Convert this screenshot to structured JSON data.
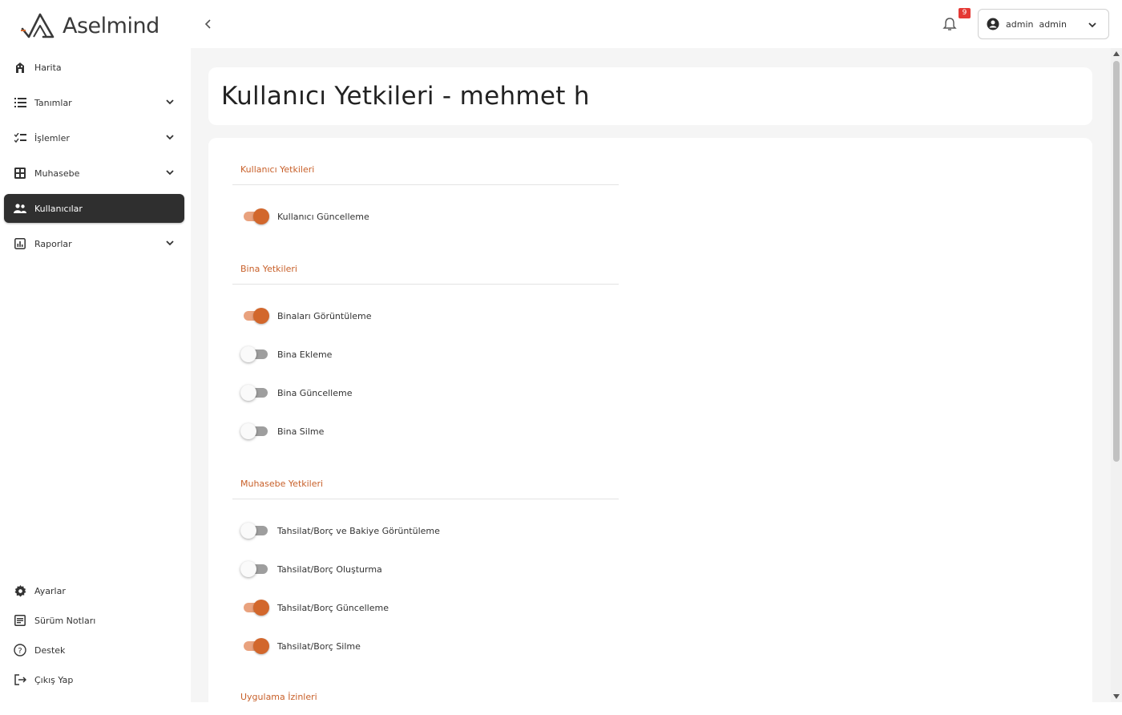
{
  "brand": {
    "name": "Aselmind",
    "accent_color": "#c8602a",
    "active_nav_color": "#2f2f2f"
  },
  "sidebar": {
    "items": [
      {
        "label": "Harita",
        "icon": "building-icon",
        "has_submenu": false,
        "active": false
      },
      {
        "label": "Tanımlar",
        "icon": "list-icon",
        "has_submenu": true,
        "active": false
      },
      {
        "label": "İşlemler",
        "icon": "checklist-icon",
        "has_submenu": true,
        "active": false
      },
      {
        "label": "Muhasebe",
        "icon": "grid-icon",
        "has_submenu": true,
        "active": false
      },
      {
        "label": "Kullanıcılar",
        "icon": "users-icon",
        "has_submenu": false,
        "active": true
      },
      {
        "label": "Raporlar",
        "icon": "report-icon",
        "has_submenu": true,
        "active": false
      }
    ],
    "bottom_items": [
      {
        "label": "Ayarlar",
        "icon": "gear-icon"
      },
      {
        "label": "Sürüm Notları",
        "icon": "notes-icon"
      },
      {
        "label": "Destek",
        "icon": "help-icon"
      },
      {
        "label": "Çıkış Yap",
        "icon": "logout-icon"
      }
    ]
  },
  "header": {
    "notification_count": "9",
    "user_label": "admin  admin"
  },
  "page": {
    "title": "Kullanıcı Yetkileri - mehmet h"
  },
  "sections": [
    {
      "title": "Kullanıcı Yetkileri",
      "permissions": [
        {
          "label": "Kullanıcı Güncelleme",
          "enabled": true
        }
      ]
    },
    {
      "title": "Bina Yetkileri",
      "permissions": [
        {
          "label": "Binaları Görüntüleme",
          "enabled": true
        },
        {
          "label": "Bina Ekleme",
          "enabled": false
        },
        {
          "label": "Bina Güncelleme",
          "enabled": false
        },
        {
          "label": "Bina Silme",
          "enabled": false
        }
      ]
    },
    {
      "title": "Muhasebe Yetkileri",
      "permissions": [
        {
          "label": "Tahsilat/Borç ve Bakiye Görüntüleme",
          "enabled": false
        },
        {
          "label": "Tahsilat/Borç Oluşturma",
          "enabled": false
        },
        {
          "label": "Tahsilat/Borç Güncelleme",
          "enabled": true
        },
        {
          "label": "Tahsilat/Borç Silme",
          "enabled": true
        }
      ]
    },
    {
      "title": "Uygulama İzinleri",
      "permissions": []
    }
  ]
}
